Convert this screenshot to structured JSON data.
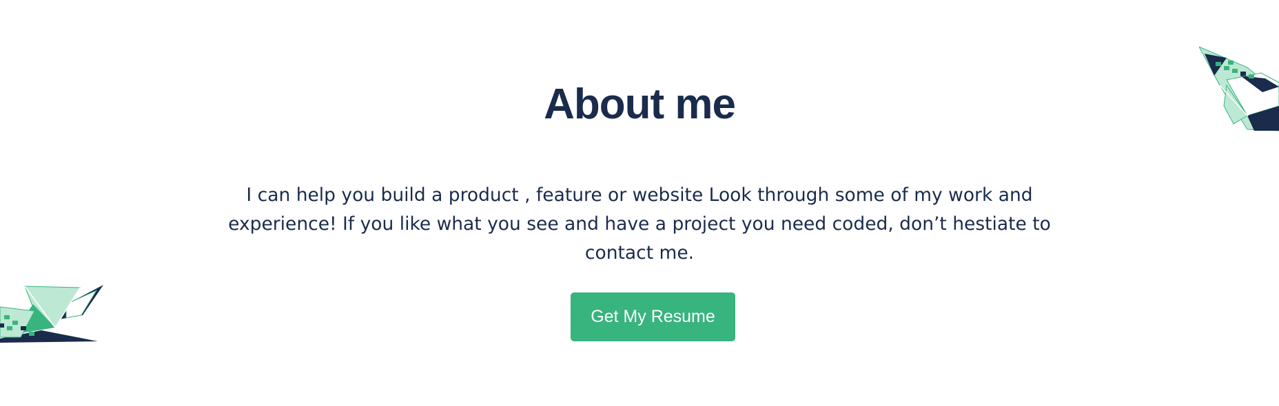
{
  "about": {
    "title": "About me",
    "description": "I can help you build a product , feature or website Look through some of my work and experience! If you like what you see and have a project you need coded, don’t hestiate to contact me.",
    "resume_button_label": "Get My Resume"
  },
  "colors": {
    "heading": "#1a2b4c",
    "body_text": "#1a2b4c",
    "button_background": "#38b47f",
    "button_text": "#ffffff",
    "crane_navy": "#1a2b4c",
    "crane_green": "#38b47f",
    "crane_mint": "#bde8d4"
  },
  "decorations": {
    "left": "paper-crane-icon",
    "right": "paper-crane-icon"
  }
}
